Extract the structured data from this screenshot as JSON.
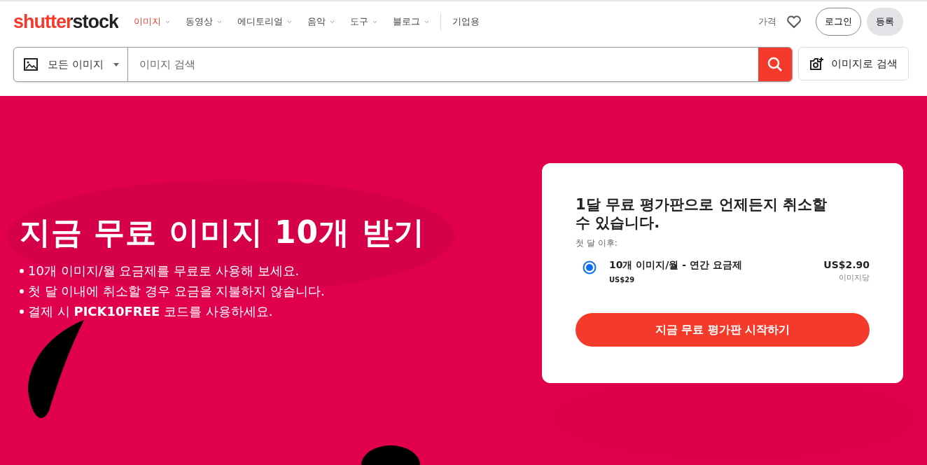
{
  "logo": {
    "text": "shutterstock"
  },
  "nav": [
    {
      "label": "이미지",
      "selected": true,
      "has_menu": true
    },
    {
      "label": "동영상",
      "selected": false,
      "has_menu": true
    },
    {
      "label": "에디토리얼",
      "selected": false,
      "has_menu": true
    },
    {
      "label": "음악",
      "selected": false,
      "has_menu": true
    },
    {
      "label": "도구",
      "selected": false,
      "has_menu": true
    },
    {
      "label": "블로그",
      "selected": false,
      "has_menu": true
    },
    {
      "label": "기업용",
      "selected": false,
      "has_menu": false
    }
  ],
  "header_right": {
    "pricing": "가격",
    "login": "로그인",
    "signup": "등록"
  },
  "search": {
    "category": "모든 이미지",
    "placeholder": "이미지 검색",
    "image_search": "이미지로 검색"
  },
  "hero": {
    "title": "지금 무료 이미지 10개 받기",
    "bullets": [
      "10개 이미지/월 요금제를 무료로 사용해 보세요.",
      "첫 달 이내에 취소할 경우 요금을 지불하지 않습니다.",
      "결제 시 **PICK10FREE** 코드를 사용하세요."
    ]
  },
  "offer": {
    "title": "1달 무료 평가판으로 언제든지 취소할 수 있습니다.",
    "subtitle": "첫 달 이후:",
    "plans": [
      {
        "name": "10개 이미지/월 - 연간 요금제",
        "total": "US$29",
        "price": "US$2.90",
        "unit": "이미지당",
        "selected": true
      }
    ],
    "cta": "지금 무료 평가판 시작하기"
  }
}
